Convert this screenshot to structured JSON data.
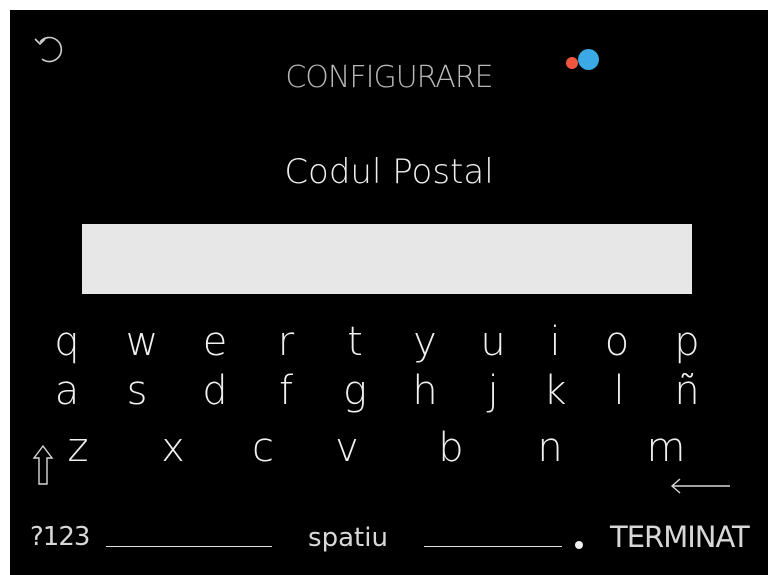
{
  "header": {
    "title": "CONFIGURARE",
    "logo_colors": {
      "red": "#f0563e",
      "blue": "#3aa9e6"
    }
  },
  "prompt": {
    "label": "Codul Postal"
  },
  "input": {
    "value": "",
    "background": "#e7e7e8"
  },
  "keyboard": {
    "row1": [
      "q",
      "w",
      "e",
      "r",
      "t",
      "y",
      "u",
      "i",
      "o",
      "p"
    ],
    "row2": [
      "a",
      "s",
      "d",
      "f",
      "g",
      "h",
      "j",
      "k",
      "l",
      "ñ"
    ],
    "row3": [
      "z",
      "x",
      "c",
      "v",
      "b",
      "n",
      "m"
    ],
    "numbers_label": "?123",
    "space_label": "spatiu",
    "done_label": "TERMINAT",
    "shift_icon": "shift-up-arrow-icon",
    "backspace_icon": "left-arrow-icon",
    "back_icon": "undo-arrow-icon"
  }
}
